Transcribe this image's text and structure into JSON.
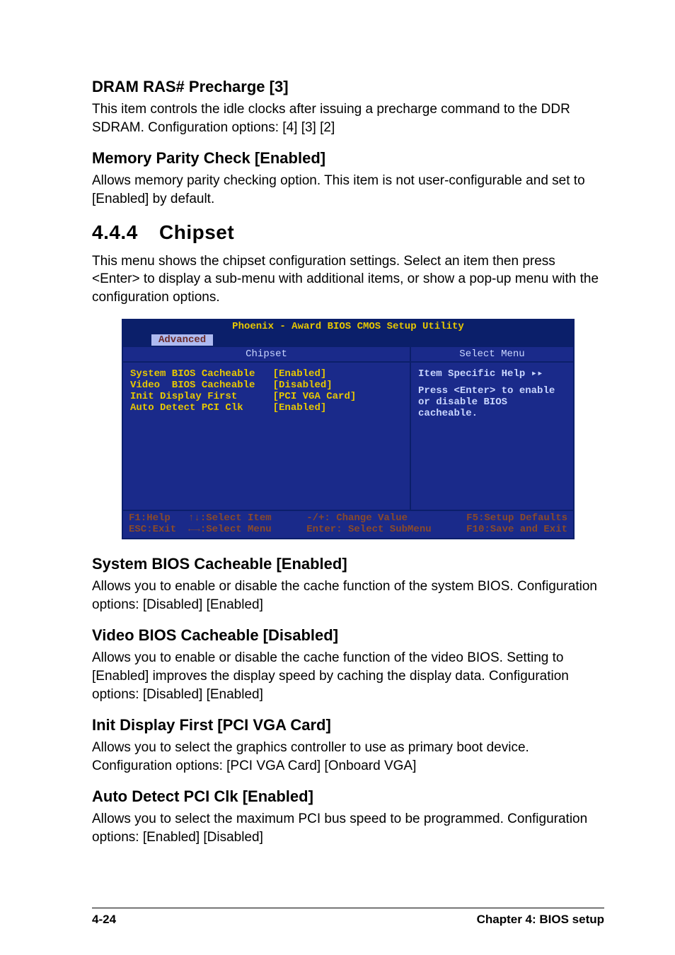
{
  "sections": {
    "dram": {
      "title": "DRAM RAS# Precharge [3]",
      "text": "This item controls the idle clocks after issuing a precharge command to the DDR SDRAM. Configuration options: [4] [3] [2]"
    },
    "parity": {
      "title": "Memory Parity Check [Enabled]",
      "text": "Allows memory parity checking option. This item is not user-configurable and set to [Enabled] by default."
    },
    "chipset_h": {
      "num": "4.4.4",
      "title": "Chipset",
      "text": "This menu shows the chipset configuration settings. Select an item then press <Enter> to display a sub-menu with additional items, or show a pop-up menu with the configuration options."
    },
    "sysbios": {
      "title": "System BIOS Cacheable [Enabled]",
      "text": "Allows you to enable or disable the cache function of the system BIOS. Configuration options: [Disabled] [Enabled]"
    },
    "vidbios": {
      "title": "Video BIOS Cacheable [Disabled]",
      "text": "Allows you to enable or disable the cache function of the video BIOS. Setting to [Enabled] improves the display speed by caching the display data. Configuration options: [Disabled] [Enabled]"
    },
    "init": {
      "title": "Init Display First [PCI VGA Card]",
      "text": "Allows you to select the graphics controller to use as primary boot device. Configuration options: [PCI VGA Card] [Onboard VGA]"
    },
    "autodet": {
      "title": "Auto Detect PCI Clk [Enabled]",
      "text": "Allows you to select the maximum PCI bus speed to be programmed. Configuration options: [Enabled] [Disabled]"
    }
  },
  "bios": {
    "title": "Phoenix - Award BIOS CMOS Setup Utility",
    "tab": "Advanced",
    "head_left": "Chipset",
    "head_right": "Select Menu",
    "items": [
      {
        "name": "System BIOS Cacheable",
        "value": "[Enabled]"
      },
      {
        "name": "Video  BIOS Cacheable",
        "value": "[Disabled]"
      },
      {
        "name": "Init Display First",
        "value": "[PCI VGA Card]"
      },
      {
        "name": "Auto Detect PCI Clk",
        "value": "[Enabled]"
      }
    ],
    "help_title": "Item Specific Help ▸▸",
    "help_text": "Press <Enter> to enable or disable BIOS cacheable.",
    "footer": {
      "c1": "F1:Help   ↑↓:Select Item\nESC:Exit  ←→:Select Menu",
      "c2": "-/+: Change Value\nEnter: Select SubMenu",
      "c3": "F5:Setup Defaults\nF10:Save and Exit"
    }
  },
  "footer": {
    "left": "4-24",
    "right": "Chapter 4: BIOS setup"
  }
}
